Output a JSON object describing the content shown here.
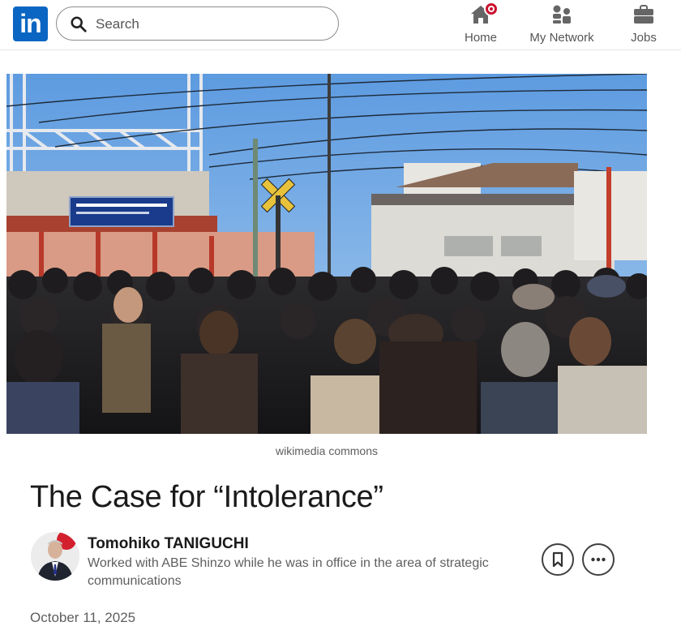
{
  "header": {
    "logo_text": "in",
    "search": {
      "placeholder": "Search",
      "value": ""
    },
    "nav": [
      {
        "label": "Home",
        "icon": "home-icon",
        "has_notification": true
      },
      {
        "label": "My Network",
        "icon": "people-icon"
      },
      {
        "label": "Jobs",
        "icon": "briefcase-icon"
      }
    ]
  },
  "article": {
    "image_caption": "wikimedia commons",
    "title": "The Case for “Intolerance”",
    "author": {
      "name": "Tomohiko TANIGUCHI",
      "headline": "Worked with ABE Shinzo while he was in office in the area of strategic communications"
    },
    "date": "October 11, 2025"
  },
  "colors": {
    "brand": "#0a66c2",
    "notification": "#cb112d",
    "text_secondary": "#5e5e5e"
  }
}
